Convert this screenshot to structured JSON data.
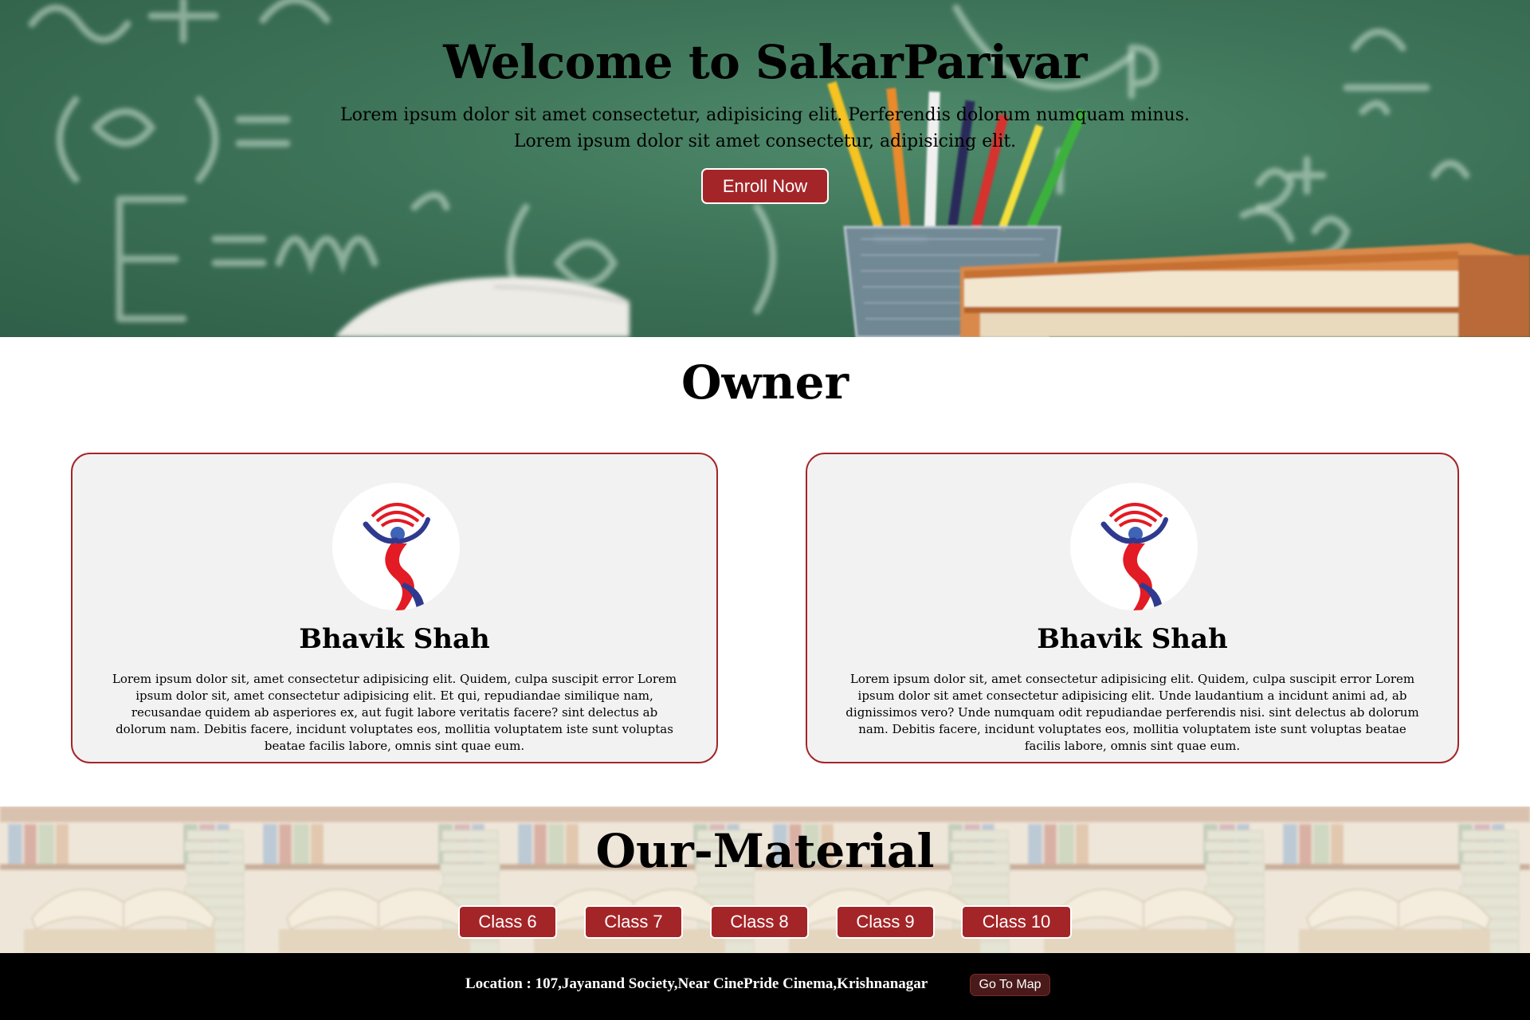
{
  "hero": {
    "title": "Welcome to SakarParivar",
    "subtitle_line1": "Lorem ipsum dolor sit amet consectetur, adipisicing elit. Perferendis dolorum numquam minus.",
    "subtitle_line2": "Lorem ipsum dolor sit amet consectetur, adipisicing elit.",
    "enroll_label": "Enroll Now",
    "background": "chalkboard-with-pencils-and-books"
  },
  "owner": {
    "heading": "Owner",
    "cards": [
      {
        "name": "Bhavik Shah",
        "description": "Lorem ipsum dolor sit, amet consectetur adipisicing elit. Quidem, culpa suscipit error Lorem ipsum dolor sit, amet consectetur adipisicing elit. Et qui, repudiandae similique nam, recusandae quidem ab asperiores ex, aut fugit labore veritatis facere? sint delectus ab dolorum nam. Debitis facere, incidunt voluptates eos, mollitia voluptatem iste sunt voluptas beatae facilis labore, omnis sint quae eum.",
        "avatar_icon": "sakar-parivar-logo-icon"
      },
      {
        "name": "Bhavik Shah",
        "description": "Lorem ipsum dolor sit, amet consectetur adipisicing elit. Quidem, culpa suscipit error Lorem ipsum dolor sit amet consectetur adipisicing elit. Unde laudantium a incidunt animi ad, ab dignissimos vero? Unde numquam odit repudiandae perferendis nisi. sint delectus ab dolorum nam. Debitis facere, incidunt voluptates eos, mollitia voluptatem iste sunt voluptas beatae facilis labore, omnis sint quae eum.",
        "avatar_icon": "sakar-parivar-logo-icon"
      }
    ]
  },
  "material": {
    "heading": "Our-Material",
    "background": "open-books-on-shelves",
    "classes": [
      "Class 6",
      "Class 7",
      "Class 8",
      "Class 9",
      "Class 10"
    ]
  },
  "footer": {
    "location": "Location : 107,Jayanand Society,Near CinePride Cinema,Krishnanagar",
    "map_button": "Go To Map"
  },
  "colors": {
    "accent": "#a42528",
    "card_bg": "#f2f2f2",
    "footer_bg": "#000000",
    "chalkboard": "#3d7358",
    "logo_red": "#e21b24",
    "logo_blue": "#2f3a8f"
  }
}
